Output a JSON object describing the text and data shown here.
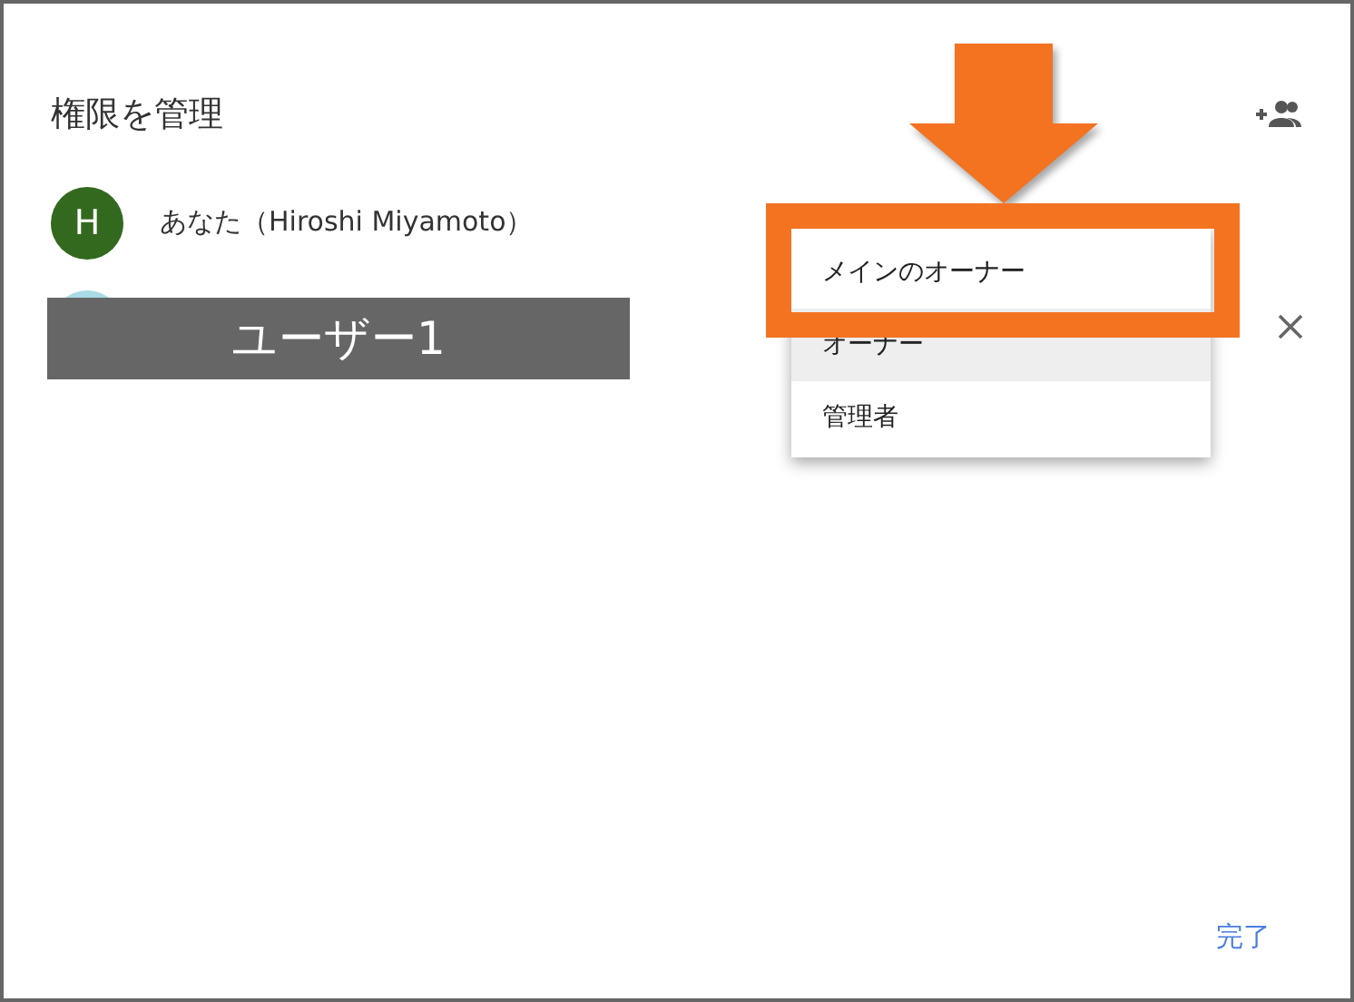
{
  "dialog": {
    "title": "権限を管理",
    "done_button": "完了"
  },
  "users": [
    {
      "avatar_letter": "H",
      "color": "#33691e",
      "name": "あなた（Hiroshi Miyamoto）",
      "removable": false
    },
    {
      "color": "#a9dbe5",
      "removable": true
    }
  ],
  "role_menu": {
    "items": [
      {
        "label": "メインのオーナー",
        "selected": false
      },
      {
        "label": "オーナー",
        "selected": true
      },
      {
        "label": "管理者",
        "selected": false
      }
    ]
  },
  "annotations": [
    {
      "kind": "arrow"
    },
    {
      "kind": "frame"
    },
    {
      "kind": "label",
      "text": "ユーザー1"
    }
  ]
}
